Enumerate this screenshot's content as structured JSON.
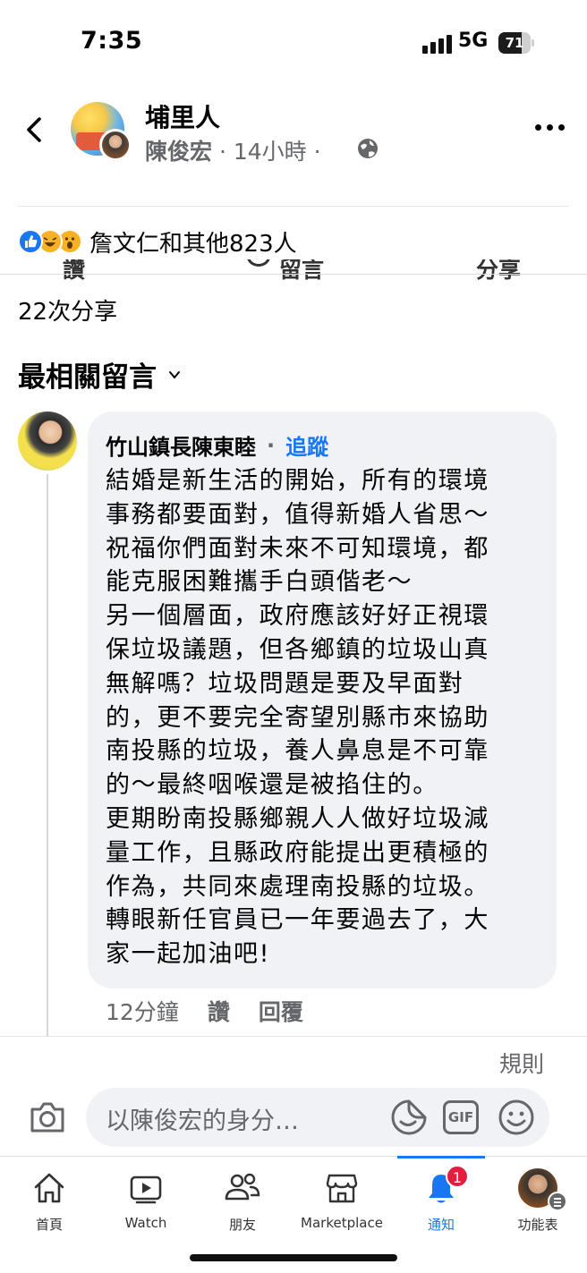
{
  "status_bar": {
    "time": "7:35",
    "network": "5G",
    "battery": "71",
    "battery_level": 0.71
  },
  "post": {
    "group_name": "埔里人",
    "author": "陳俊宏",
    "time": "14小時",
    "meta_separator": "·"
  },
  "actions": {
    "like": "讚",
    "comment": "留言",
    "share": "分享"
  },
  "reactions": {
    "summary": "詹文仁和其他823人"
  },
  "shares": "22次分享",
  "sort_label": "最相關留言",
  "comment": {
    "author": "竹山鎮長陳東睦",
    "separator": "·",
    "follow": "追蹤",
    "body": "結婚是新生活的開始，所有的環境\n事務都要面對，值得新婚人省思～\n祝福你們面對未來不可知環境，都\n能克服困難攜手白頭偕老～\n另一個層面，政府應該好好正視環\n保垃圾議題，但各鄉鎮的垃圾山真\n無解嗎？垃圾問題是要及早面對\n的，更不要完全寄望別縣市來協助\n南投縣的垃圾，養人鼻息是不可靠\n的～最終咽喉還是被掐住的。\n更期盼南投縣鄉親人人做好垃圾減\n量工作，且縣政府能提出更積極的\n作為，共同來處理南投縣的垃圾。\n轉眼新任官員已一年要過去了，大\n家一起加油吧!",
    "time": "12分鐘",
    "like": "讚",
    "reply": "回覆"
  },
  "rules": "規則",
  "composer": {
    "placeholder": "以陳俊宏的身分…",
    "gif": "GIF"
  },
  "nav": {
    "items": [
      {
        "label": "首頁",
        "icon": "home-icon"
      },
      {
        "label": "Watch",
        "icon": "watch-icon"
      },
      {
        "label": "朋友",
        "icon": "friends-icon"
      },
      {
        "label": "Marketplace",
        "icon": "marketplace-icon"
      },
      {
        "label": "通知",
        "icon": "bell-icon",
        "badge": "1",
        "active": true
      },
      {
        "label": "功能表",
        "icon": "menu-avatar"
      }
    ]
  },
  "colors": {
    "accent": "#1877f2",
    "text": "#050505",
    "secondary": "#65676b",
    "bubble": "#f0f2f5",
    "badge": "#e41e3f"
  }
}
